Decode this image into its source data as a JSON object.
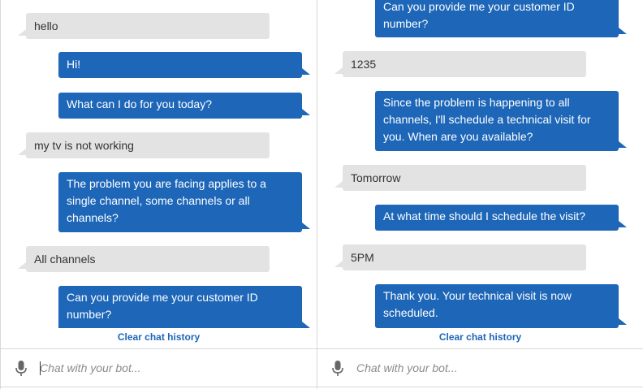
{
  "left_panel": {
    "messages": [
      {
        "from": "user",
        "text": "hello"
      },
      {
        "from": "bot",
        "text": "Hi!"
      },
      {
        "from": "bot",
        "text": "What can I do for you today?"
      },
      {
        "from": "user",
        "text": "my tv is not working"
      },
      {
        "from": "bot",
        "text": "The problem you are facing applies to a single channel, some channels or all channels?"
      },
      {
        "from": "user",
        "text": "All channels"
      },
      {
        "from": "bot",
        "text": "Can you provide me your customer ID number?"
      }
    ],
    "clear_label": "Clear chat history",
    "input_placeholder": "Chat with your bot...",
    "mic_icon": "microphone-icon"
  },
  "right_panel": {
    "messages": [
      {
        "from": "bot",
        "text": "Can you provide me your customer ID number?"
      },
      {
        "from": "user",
        "text": "1235"
      },
      {
        "from": "bot",
        "text": "Since the problem is happening to all channels, I'll schedule a technical visit for you. When are you available?"
      },
      {
        "from": "user",
        "text": "Tomorrow"
      },
      {
        "from": "bot",
        "text": "At what time should I schedule the visit?"
      },
      {
        "from": "user",
        "text": "5PM"
      },
      {
        "from": "bot",
        "text": "Thank you. Your technical visit is now scheduled."
      }
    ],
    "clear_label": "Clear chat history",
    "input_placeholder": "Chat with your bot...",
    "mic_icon": "microphone-icon"
  },
  "colors": {
    "bot_bubble": "#1d66b8",
    "user_bubble": "#e3e3e3",
    "link": "#1d66b8"
  }
}
